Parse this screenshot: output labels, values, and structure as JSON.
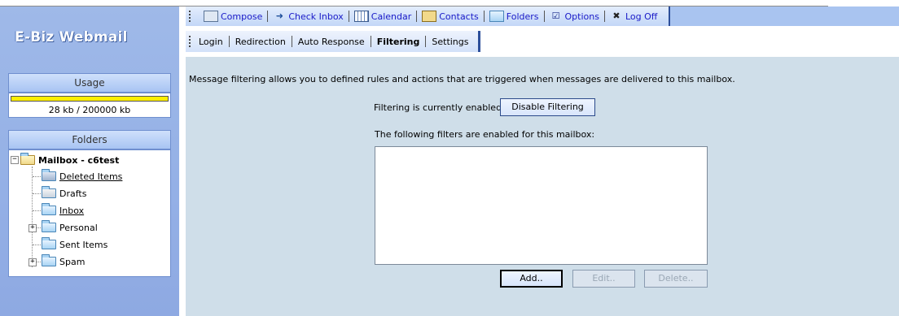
{
  "app": {
    "logo": "E-Biz Webmail"
  },
  "sidebar": {
    "usage": {
      "heading": "Usage",
      "text": "28 kb / 200000 kb",
      "fill_fraction": 1.0,
      "bar_color": "#ffee00"
    },
    "folders": {
      "heading": "Folders",
      "root": "Mailbox - c6test",
      "items": [
        {
          "label": "Deleted Items",
          "icon": "deleted-items-folder-icon"
        },
        {
          "label": "Drafts",
          "icon": "drafts-folder-icon"
        },
        {
          "label": "Inbox",
          "icon": "folder-icon"
        },
        {
          "label": "Personal",
          "icon": "folder-icon"
        },
        {
          "label": "Sent Items",
          "icon": "folder-icon"
        },
        {
          "label": "Spam",
          "icon": "folder-icon"
        }
      ]
    }
  },
  "toolbar": {
    "items": [
      {
        "label": "Compose",
        "icon": "compose-icon"
      },
      {
        "label": "Check Inbox",
        "icon": "arrow-icon"
      },
      {
        "label": "Calendar",
        "icon": "calendar-icon"
      },
      {
        "label": "Contacts",
        "icon": "contacts-book-icon"
      },
      {
        "label": "Folders",
        "icon": "folder-icon"
      },
      {
        "label": "Options",
        "icon": "checkbox-icon"
      },
      {
        "label": "Log Off",
        "icon": "log-off-icon"
      }
    ]
  },
  "subtabs": {
    "items": [
      "Login",
      "Redirection",
      "Auto Response",
      "Filtering",
      "Settings"
    ],
    "active": "Filtering"
  },
  "main": {
    "intro": "Message filtering allows you to defined rules and actions that are triggered when messages are delivered to this mailbox.",
    "status": "Filtering is currently enabled",
    "disable_button": "Disable Filtering",
    "filters_label": "The following filters are enabled for this mailbox:",
    "add_button": "Add..",
    "edit_button": "Edit..",
    "delete_button": "Delete.."
  },
  "colors": {
    "accent": "#2d4f9a",
    "sidebar_bg": "#94b0e6",
    "content_bg": "#cfdee9",
    "link": "#1a1ac8"
  }
}
